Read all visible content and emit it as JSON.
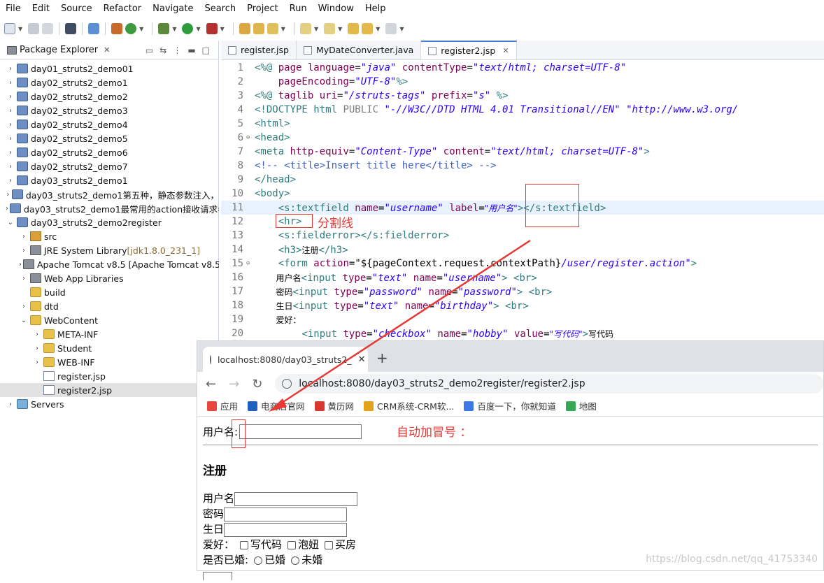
{
  "menu": [
    "File",
    "Edit",
    "Source",
    "Refactor",
    "Navigate",
    "Search",
    "Project",
    "Run",
    "Window",
    "Help"
  ],
  "package_explorer": {
    "title": "Package Explorer",
    "tree": [
      {
        "label": "day01_struts2_demo01",
        "level": 0,
        "chevron": "›",
        "icon": "proj"
      },
      {
        "label": "day02_struts2_demo1",
        "level": 0,
        "chevron": "›",
        "icon": "proj"
      },
      {
        "label": "day02_struts2_demo2",
        "level": 0,
        "chevron": "›",
        "icon": "proj"
      },
      {
        "label": "day02_struts2_demo3",
        "level": 0,
        "chevron": "›",
        "icon": "proj"
      },
      {
        "label": "day02_struts2_demo4",
        "level": 0,
        "chevron": "›",
        "icon": "proj"
      },
      {
        "label": "day02_struts2_demo5",
        "level": 0,
        "chevron": "›",
        "icon": "proj"
      },
      {
        "label": "day02_struts2_demo6",
        "level": 0,
        "chevron": "›",
        "icon": "proj"
      },
      {
        "label": "day02_struts2_demo7",
        "level": 0,
        "chevron": "›",
        "icon": "proj"
      },
      {
        "label": "day03_struts2_demo1",
        "level": 0,
        "chevron": "›",
        "icon": "proj"
      },
      {
        "label": "day03_struts2_demo1第五种，静态参数注入，",
        "level": 0,
        "chevron": "›",
        "icon": "proj"
      },
      {
        "label": "day03_struts2_demo1最常用的action接收请求参",
        "level": 0,
        "chevron": "›",
        "icon": "proj"
      },
      {
        "label": "day03_struts2_demo2register",
        "level": 0,
        "chevron": "⌄",
        "icon": "proj"
      },
      {
        "label": "src",
        "level": 1,
        "chevron": "›",
        "icon": "src"
      },
      {
        "label": "JRE System Library",
        "extra": " [jdk1.8.0_231_1]",
        "level": 1,
        "chevron": "›",
        "icon": "lib"
      },
      {
        "label": "Apache Tomcat v8.5 [Apache Tomcat v8.5",
        "level": 1,
        "chevron": "›",
        "icon": "lib"
      },
      {
        "label": "Web App Libraries",
        "level": 1,
        "chevron": "›",
        "icon": "lib"
      },
      {
        "label": "build",
        "level": 1,
        "chevron": "",
        "icon": "folder"
      },
      {
        "label": "dtd",
        "level": 1,
        "chevron": "›",
        "icon": "folder"
      },
      {
        "label": "WebContent",
        "level": 1,
        "chevron": "⌄",
        "icon": "folder"
      },
      {
        "label": "META-INF",
        "level": 2,
        "chevron": "›",
        "icon": "folder"
      },
      {
        "label": "Student",
        "level": 2,
        "chevron": "›",
        "icon": "folder"
      },
      {
        "label": "WEB-INF",
        "level": 2,
        "chevron": "›",
        "icon": "folder"
      },
      {
        "label": "register.jsp",
        "level": 2,
        "chevron": "",
        "icon": "jsp"
      },
      {
        "label": "register2.jsp",
        "level": 2,
        "chevron": "",
        "icon": "jsp",
        "selected": true
      },
      {
        "label": "Servers",
        "level": 0,
        "chevron": "›",
        "icon": "srv"
      }
    ]
  },
  "editor_tabs": [
    {
      "label": "register.jsp",
      "active": false
    },
    {
      "label": "MyDateConverter.java",
      "active": false
    },
    {
      "label": "register2.jsp",
      "active": true
    }
  ],
  "code_lines": [
    {
      "n": "1",
      "fold": "",
      "spans": [
        [
          "t-tag",
          "<%@ "
        ],
        [
          "t-attr",
          "page "
        ],
        [
          "t-attr",
          "language"
        ],
        [
          "t-pl",
          "="
        ],
        [
          "t-str",
          "\"java\""
        ],
        [
          "t-pl",
          " "
        ],
        [
          "t-attr",
          "contentType"
        ],
        [
          "t-pl",
          "="
        ],
        [
          "t-str",
          "\"text/html; charset=UTF-8\""
        ]
      ]
    },
    {
      "n": "2",
      "fold": "",
      "spans": [
        [
          "t-pl",
          "    "
        ],
        [
          "t-attr",
          "pageEncoding"
        ],
        [
          "t-pl",
          "="
        ],
        [
          "t-str",
          "\"UTF-8\""
        ],
        [
          "t-tag",
          "%>"
        ]
      ]
    },
    {
      "n": "3",
      "fold": "",
      "spans": [
        [
          "t-tag",
          "<%@ "
        ],
        [
          "t-attr",
          "taglib "
        ],
        [
          "t-attr",
          "uri"
        ],
        [
          "t-pl",
          "="
        ],
        [
          "t-str",
          "\"/struts-tags\""
        ],
        [
          "t-pl",
          " "
        ],
        [
          "t-attr",
          "prefix"
        ],
        [
          "t-pl",
          "="
        ],
        [
          "t-str",
          "\"s\""
        ],
        [
          "t-pl",
          " "
        ],
        [
          "t-tag",
          "%>"
        ]
      ]
    },
    {
      "n": "4",
      "fold": "",
      "spans": [
        [
          "t-tag",
          "<!DOCTYPE "
        ],
        [
          "t-tag",
          "html "
        ],
        [
          "t-doc",
          "PUBLIC "
        ],
        [
          "t-str",
          "\"-//W3C//DTD HTML 4.01 Transitional//EN\""
        ],
        [
          "t-pl",
          " "
        ],
        [
          "t-str",
          "\"http://www.w3.org/"
        ]
      ]
    },
    {
      "n": "5",
      "fold": "",
      "spans": [
        [
          "t-tag",
          "<html>"
        ]
      ]
    },
    {
      "n": "6",
      "fold": "⊖",
      "spans": [
        [
          "t-tag",
          "<head>"
        ]
      ]
    },
    {
      "n": "7",
      "fold": "",
      "spans": [
        [
          "t-tag",
          "<meta "
        ],
        [
          "t-attr",
          "http-equiv"
        ],
        [
          "t-pl",
          "="
        ],
        [
          "t-str",
          "\"Content-Type\""
        ],
        [
          "t-pl",
          " "
        ],
        [
          "t-attr",
          "content"
        ],
        [
          "t-pl",
          "="
        ],
        [
          "t-str",
          "\"text/html; charset=UTF-8\""
        ],
        [
          "t-tag",
          ">"
        ]
      ]
    },
    {
      "n": "8",
      "fold": "",
      "spans": [
        [
          "t-cm",
          "<!-- <title>Insert title here</title> -->"
        ]
      ]
    },
    {
      "n": "9",
      "fold": "",
      "spans": [
        [
          "t-tag",
          "</head>"
        ]
      ]
    },
    {
      "n": "10",
      "fold": "",
      "spans": [
        [
          "t-tag",
          "<body>"
        ]
      ]
    },
    {
      "n": "11",
      "fold": "",
      "hl": true,
      "spans": [
        [
          "t-pl",
          "    "
        ],
        [
          "t-tag",
          "<s:textfield "
        ],
        [
          "t-attr",
          "name"
        ],
        [
          "t-pl",
          "="
        ],
        [
          "t-str",
          "\"username\""
        ],
        [
          "t-pl",
          " "
        ],
        [
          "t-attr",
          "label"
        ],
        [
          "t-pl",
          "="
        ],
        [
          "t-str",
          "\"用户名\""
        ],
        [
          "t-tag",
          ">"
        ],
        [
          "t-tag",
          "</s:textfield>"
        ]
      ]
    },
    {
      "n": "12",
      "fold": "",
      "spans": [
        [
          "t-pl",
          "    "
        ],
        [
          "t-tag",
          "<hr>"
        ]
      ]
    },
    {
      "n": "13",
      "fold": "",
      "spans": [
        [
          "t-pl",
          "    "
        ],
        [
          "t-tag",
          "<s:fielderror></s:fielderror>"
        ]
      ]
    },
    {
      "n": "14",
      "fold": "",
      "spans": [
        [
          "t-pl",
          "    "
        ],
        [
          "t-tag",
          "<h3>"
        ],
        [
          "t-pl",
          "注册"
        ],
        [
          "t-tag",
          "</h3>"
        ]
      ]
    },
    {
      "n": "15",
      "fold": "⊖",
      "spans": [
        [
          "t-pl",
          "    "
        ],
        [
          "t-tag",
          "<form "
        ],
        [
          "t-attr",
          "action"
        ],
        [
          "t-pl",
          "="
        ],
        [
          "t-pl",
          "\"${pageContext.request.contextPath}"
        ],
        [
          "t-str",
          "/user/register.action\""
        ],
        [
          "t-tag",
          ">"
        ]
      ]
    },
    {
      "n": "16",
      "fold": "",
      "spans": [
        [
          "t-pl",
          "        用户名"
        ],
        [
          "t-tag",
          "<input "
        ],
        [
          "t-attr",
          "type"
        ],
        [
          "t-pl",
          "="
        ],
        [
          "t-str",
          "\"text\""
        ],
        [
          "t-pl",
          " "
        ],
        [
          "t-attr",
          "name"
        ],
        [
          "t-pl",
          "="
        ],
        [
          "t-str",
          "\"username\""
        ],
        [
          "t-tag",
          "> <br>"
        ]
      ]
    },
    {
      "n": "17",
      "fold": "",
      "spans": [
        [
          "t-pl",
          "        密码"
        ],
        [
          "t-tag",
          "<input "
        ],
        [
          "t-attr",
          "type"
        ],
        [
          "t-pl",
          "="
        ],
        [
          "t-str",
          "\"password\""
        ],
        [
          "t-pl",
          " "
        ],
        [
          "t-attr",
          "name"
        ],
        [
          "t-pl",
          "="
        ],
        [
          "t-str",
          "\"password\""
        ],
        [
          "t-tag",
          "> <br>"
        ]
      ]
    },
    {
      "n": "18",
      "fold": "",
      "spans": [
        [
          "t-pl",
          "        生日"
        ],
        [
          "t-tag",
          "<input "
        ],
        [
          "t-attr",
          "type"
        ],
        [
          "t-pl",
          "="
        ],
        [
          "t-str",
          "\"text\""
        ],
        [
          "t-pl",
          " "
        ],
        [
          "t-attr",
          "name"
        ],
        [
          "t-pl",
          "="
        ],
        [
          "t-str",
          "\"birthday\""
        ],
        [
          "t-tag",
          "> <br>"
        ]
      ]
    },
    {
      "n": "19",
      "fold": "",
      "spans": [
        [
          "t-pl",
          "        爱好："
        ]
      ]
    },
    {
      "n": "20",
      "fold": "",
      "spans": [
        [
          "t-pl",
          "        "
        ],
        [
          "t-tag",
          "<input "
        ],
        [
          "t-attr",
          "type"
        ],
        [
          "t-pl",
          "="
        ],
        [
          "t-str",
          "\"checkbox\""
        ],
        [
          "t-pl",
          " "
        ],
        [
          "t-attr",
          "name"
        ],
        [
          "t-pl",
          "="
        ],
        [
          "t-str",
          "\"hobby\""
        ],
        [
          "t-pl",
          " "
        ],
        [
          "t-attr",
          "value"
        ],
        [
          "t-pl",
          "="
        ],
        [
          "t-str",
          "\"写代码\""
        ],
        [
          "t-tag",
          ">"
        ],
        [
          "t-pl",
          "写代码"
        ]
      ]
    }
  ],
  "annotations": {
    "hr_note": "分割线",
    "colon_note": "自动加冒号 ："
  },
  "browser": {
    "tab_title": "localhost:8080/day03_struts2_",
    "url": "localhost:8080/day03_struts2_demo2register/register2.jsp",
    "bookmarks": [
      "应用",
      "电商店官网",
      "黄历网",
      "CRM系统-CRM软...",
      "百度一下，你就知道",
      "地图"
    ],
    "page": {
      "username_label": "用户名:",
      "heading": "注册",
      "form_username": "用户名",
      "form_password": "密码",
      "form_birthday": "生日",
      "hobby_label": "爱好：",
      "hobbies": [
        "写代码",
        "泡妞",
        "买房"
      ],
      "married_label": "是否已婚:",
      "married_options": [
        "已婚",
        "未婚"
      ]
    },
    "watermark": "https://blog.csdn.net/qq_41753340"
  },
  "colors": {
    "accent": "#4b7bd2",
    "annotation": "#e53935"
  }
}
